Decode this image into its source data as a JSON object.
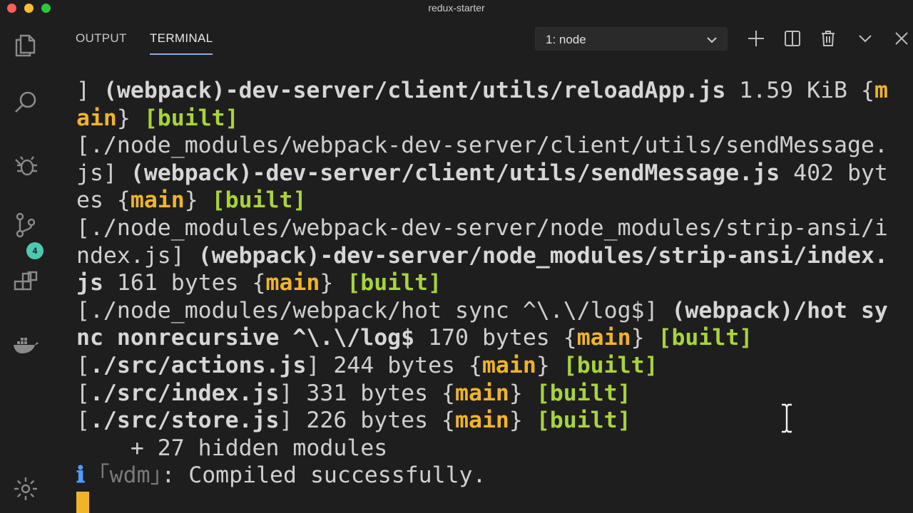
{
  "window": {
    "title": "redux-starter"
  },
  "panel": {
    "tabs": [
      {
        "label": "OUTPUT",
        "active": false
      },
      {
        "label": "TERMINAL",
        "active": true
      }
    ],
    "terminal_selector": {
      "value": "1: node"
    },
    "actions": [
      "plus-icon",
      "split-icon",
      "trash-icon",
      "chevron-down-icon",
      "close-icon"
    ]
  },
  "activity_bar": {
    "items": [
      "explorer-icon",
      "search-icon",
      "debug-icon",
      "source-control-icon",
      "extensions-icon",
      "docker-icon",
      "settings-icon"
    ],
    "source_control_badge": "4"
  },
  "colors": {
    "background": "#1e1e1e",
    "module_name": "#f0b429",
    "built_tag": "#a8d43a",
    "info": "#4f9dff"
  },
  "terminal": {
    "lines": [
      [
        {
          "t": "] ",
          "c": ""
        },
        {
          "t": "(webpack)-dev-server/client/utils/reloadApp.js",
          "c": "b"
        },
        {
          "t": " 1.59 KiB {",
          "c": ""
        },
        {
          "t": "m",
          "c": "y"
        }
      ],
      [
        {
          "t": "ain",
          "c": "y"
        },
        {
          "t": "} ",
          "c": ""
        },
        {
          "t": "[built]",
          "c": "g"
        }
      ],
      [
        {
          "t": "[./node_modules/webpack-dev-server/client/utils/sendMessage.",
          "c": ""
        }
      ],
      [
        {
          "t": "js] ",
          "c": ""
        },
        {
          "t": "(webpack)-dev-server/client/utils/sendMessage.js",
          "c": "b"
        },
        {
          "t": " 402 byt",
          "c": ""
        }
      ],
      [
        {
          "t": "es {",
          "c": ""
        },
        {
          "t": "main",
          "c": "y"
        },
        {
          "t": "} ",
          "c": ""
        },
        {
          "t": "[built]",
          "c": "g"
        }
      ],
      [
        {
          "t": "[./node_modules/webpack-dev-server/node_modules/strip-ansi/i",
          "c": ""
        }
      ],
      [
        {
          "t": "ndex.js] ",
          "c": ""
        },
        {
          "t": "(webpack)-dev-server/node_modules/strip-ansi/index.",
          "c": "b"
        }
      ],
      [
        {
          "t": "js",
          "c": "b"
        },
        {
          "t": " 161 bytes {",
          "c": ""
        },
        {
          "t": "main",
          "c": "y"
        },
        {
          "t": "} ",
          "c": ""
        },
        {
          "t": "[built]",
          "c": "g"
        }
      ],
      [
        {
          "t": "[./node_modules/webpack/hot sync ^\\.\\/log$] ",
          "c": ""
        },
        {
          "t": "(webpack)/hot sy",
          "c": "b"
        }
      ],
      [
        {
          "t": "nc nonrecursive ^\\.\\/log$",
          "c": "b"
        },
        {
          "t": " 170 bytes {",
          "c": ""
        },
        {
          "t": "main",
          "c": "y"
        },
        {
          "t": "} ",
          "c": ""
        },
        {
          "t": "[built]",
          "c": "g"
        }
      ],
      [
        {
          "t": "[",
          "c": ""
        },
        {
          "t": "./src/actions.js",
          "c": "b"
        },
        {
          "t": "] 244 bytes {",
          "c": ""
        },
        {
          "t": "main",
          "c": "y"
        },
        {
          "t": "} ",
          "c": ""
        },
        {
          "t": "[built]",
          "c": "g"
        }
      ],
      [
        {
          "t": "[",
          "c": ""
        },
        {
          "t": "./src/index.js",
          "c": "b"
        },
        {
          "t": "] 331 bytes {",
          "c": ""
        },
        {
          "t": "main",
          "c": "y"
        },
        {
          "t": "} ",
          "c": ""
        },
        {
          "t": "[built]",
          "c": "g"
        }
      ],
      [
        {
          "t": "[",
          "c": ""
        },
        {
          "t": "./src/store.js",
          "c": "b"
        },
        {
          "t": "] 226 bytes {",
          "c": ""
        },
        {
          "t": "main",
          "c": "y"
        },
        {
          "t": "} ",
          "c": ""
        },
        {
          "t": "[built]",
          "c": "g"
        }
      ],
      [
        {
          "t": "    + 27 hidden modules",
          "c": ""
        }
      ],
      [
        {
          "t": "ℹ",
          "c": "info"
        },
        {
          "t": " ｢wdm｣",
          "c": "dim"
        },
        {
          "t": ": Compiled successfully.",
          "c": ""
        }
      ]
    ]
  }
}
